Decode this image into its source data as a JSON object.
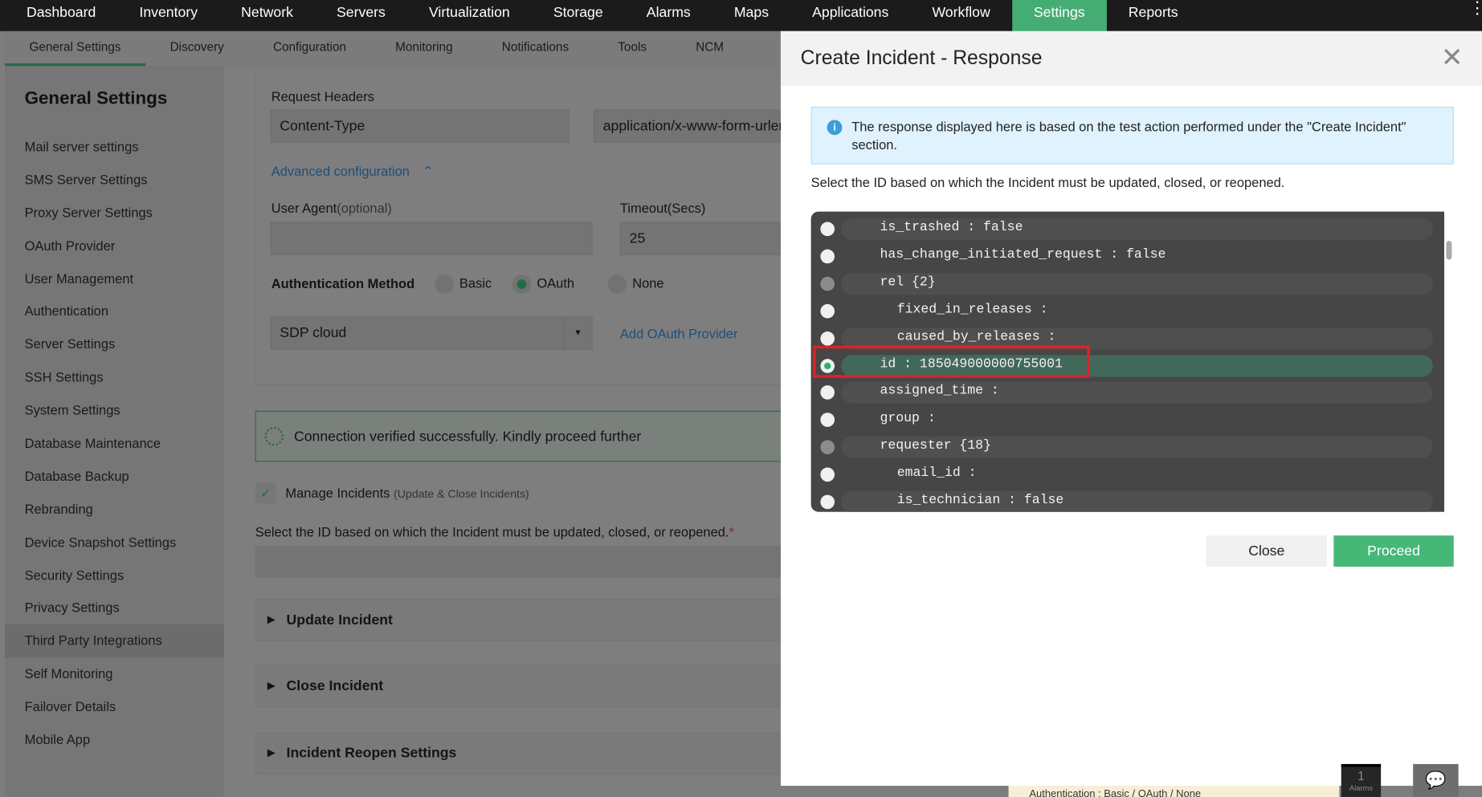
{
  "topnav": [
    "Dashboard",
    "Inventory",
    "Network",
    "Servers",
    "Virtualization",
    "Storage",
    "Alarms",
    "Maps",
    "Applications",
    "Workflow",
    "Settings",
    "Reports"
  ],
  "subnav": [
    "General Settings",
    "Discovery",
    "Configuration",
    "Monitoring",
    "Notifications",
    "Tools",
    "NCM"
  ],
  "sidebar": {
    "title": "General Settings",
    "items": [
      "Mail server settings",
      "SMS Server Settings",
      "Proxy Server Settings",
      "OAuth Provider",
      "User Management",
      "Authentication",
      "Server Settings",
      "SSH Settings",
      "System Settings",
      "Database Maintenance",
      "Database Backup",
      "Rebranding",
      "Device Snapshot Settings",
      "Security Settings",
      "Privacy Settings",
      "Third Party Integrations",
      "Self Monitoring",
      "Failover Details",
      "Mobile App"
    ]
  },
  "form": {
    "request_headers": "Request Headers",
    "header_key": "Content-Type",
    "header_value": "application/x-www-form-urlencoded",
    "advanced": "Advanced configuration",
    "user_agent": "User Agent",
    "optional": "(optional)",
    "timeout_label": "Timeout(Secs)",
    "timeout": "25",
    "auth_method": "Authentication Method",
    "basic": "Basic",
    "oauth": "OAuth",
    "none": "None",
    "provider": "SDP cloud",
    "add_provider": "Add OAuth Provider",
    "verified": "Connection verified successfully. Kindly proceed further",
    "manage": "Manage Incidents",
    "manage_sub": "(Update & Close Incidents)",
    "select_id": "Select the ID based on which the Incident must be updated, closed, or reopened.",
    "required": "*",
    "update": "Update Incident",
    "close": "Close Incident",
    "reopen": "Incident Reopen Settings"
  },
  "modal": {
    "title": "Create Incident - Response",
    "info": "The response displayed here is based on the test action performed under the \"Create Incident\" section.",
    "instruction": "Select the ID based on which the Incident must be updated, closed, or reopened.",
    "rows": [
      {
        "text": "is_trashed : false",
        "indent": 0
      },
      {
        "text": "has_change_initiated_request : false",
        "indent": 0
      },
      {
        "text": "rel {2}",
        "indent": 0,
        "group": true
      },
      {
        "text": "fixed_in_releases :",
        "indent": 1
      },
      {
        "text": "caused_by_releases :",
        "indent": 1
      },
      {
        "text": "id : 185049000000755001",
        "indent": 0,
        "selected": true
      },
      {
        "text": "assigned_time :",
        "indent": 0
      },
      {
        "text": "group :",
        "indent": 0
      },
      {
        "text": "requester {18}",
        "indent": 0,
        "group": true
      },
      {
        "text": "email_id :",
        "indent": 1
      },
      {
        "text": "is_technician : false",
        "indent": 1
      }
    ],
    "close": "Close",
    "proceed": "Proceed"
  },
  "footer": {
    "alarm_count": "1",
    "alarms": "Alarms",
    "hint": "Authentication : Basic / OAuth / None"
  }
}
